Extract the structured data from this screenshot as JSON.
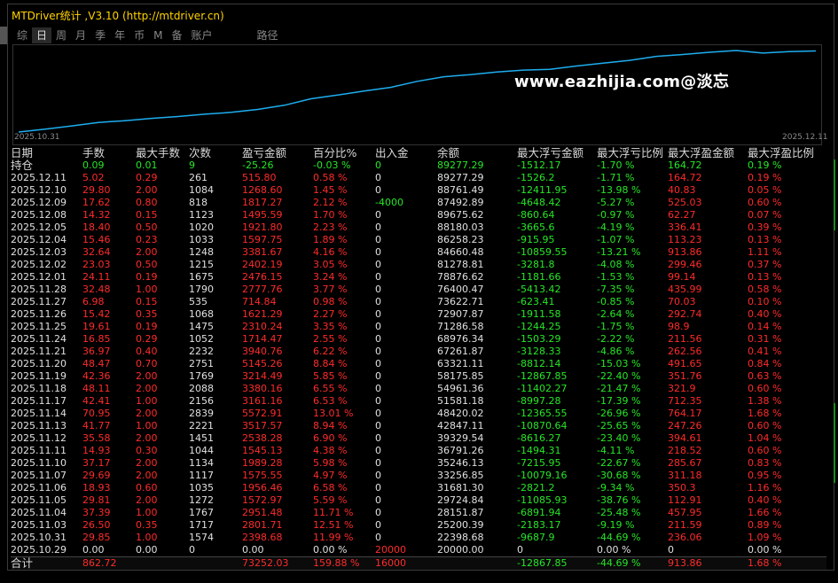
{
  "window": {
    "title": "MTDriver统计 ,V3.10 (http://mtdriver.cn)"
  },
  "tabs": [
    {
      "label": "综",
      "active": false
    },
    {
      "label": "日",
      "active": true
    },
    {
      "label": "周",
      "active": false
    },
    {
      "label": "月",
      "active": false
    },
    {
      "label": "季",
      "active": false
    },
    {
      "label": "年",
      "active": false
    },
    {
      "label": "币",
      "active": false
    },
    {
      "label": "M",
      "active": false
    },
    {
      "label": "备",
      "active": false
    },
    {
      "label": "账户",
      "active": false
    },
    {
      "label": "路径",
      "active": false
    }
  ],
  "chart": {
    "watermark": "www.eazhijia.com@淡忘",
    "x_start": "2025.10.31",
    "x_end": "2025.12.11",
    "line_color": "#1eaef0"
  },
  "chart_data": {
    "type": "line",
    "x": [
      "2025.10.29",
      "2025.10.31",
      "2025.11.03",
      "2025.11.04",
      "2025.11.05",
      "2025.11.06",
      "2025.11.07",
      "2025.11.10",
      "2025.11.11",
      "2025.11.12",
      "2025.11.13",
      "2025.11.14",
      "2025.11.17",
      "2025.11.18",
      "2025.11.19",
      "2025.11.20",
      "2025.11.21",
      "2025.11.24",
      "2025.11.25",
      "2025.11.26",
      "2025.11.27",
      "2025.11.28",
      "2025.12.01",
      "2025.12.02",
      "2025.12.03",
      "2025.12.04",
      "2025.12.05",
      "2025.12.08",
      "2025.12.09",
      "2025.12.10",
      "2025.12.11"
    ],
    "values": [
      20000.0,
      22398.68,
      25200.39,
      28151.87,
      29724.84,
      31681.3,
      33256.85,
      35246.13,
      36791.26,
      39329.54,
      42847.11,
      48420.02,
      51581.18,
      54961.36,
      58175.85,
      63321.11,
      67261.87,
      68976.34,
      71286.58,
      72907.87,
      73622.71,
      76400.47,
      78876.62,
      81278.81,
      84660.48,
      86258.23,
      88180.03,
      89675.62,
      87492.89,
      88761.49,
      89277.29
    ]
  },
  "headers": [
    "日期",
    "手数",
    "最大手数",
    "次数",
    "盈亏金额",
    "百分比%",
    "出入金",
    "余额",
    "最大浮亏金额",
    "最大浮亏比例",
    "最大浮盈金额",
    "最大浮盈比例"
  ],
  "holding": [
    "持仓",
    "0.09",
    "0.01",
    "9",
    "-25.26",
    "-0.03 %",
    "0",
    "89277.29",
    "-1512.17",
    "-1.70 %",
    "164.72",
    "0.19 %"
  ],
  "rows": [
    [
      "2025.12.11",
      "5.02",
      "0.29",
      "261",
      "515.80",
      "0.58 %",
      "0",
      "89277.29",
      "-1526.2",
      "-1.71 %",
      "164.72",
      "0.19 %"
    ],
    [
      "2025.12.10",
      "29.80",
      "2.00",
      "1084",
      "1268.60",
      "1.45 %",
      "0",
      "88761.49",
      "-12411.95",
      "-13.98 %",
      "40.83",
      "0.05 %"
    ],
    [
      "2025.12.09",
      "17.62",
      "0.80",
      "818",
      "1817.27",
      "2.12 %",
      "-4000",
      "87492.89",
      "-4648.42",
      "-5.27 %",
      "525.03",
      "0.60 %"
    ],
    [
      "2025.12.08",
      "14.32",
      "0.15",
      "1123",
      "1495.59",
      "1.70 %",
      "0",
      "89675.62",
      "-860.64",
      "-0.97 %",
      "62.27",
      "0.07 %"
    ],
    [
      "2025.12.05",
      "18.40",
      "0.50",
      "1020",
      "1921.80",
      "2.23 %",
      "0",
      "88180.03",
      "-3665.6",
      "-4.19 %",
      "336.41",
      "0.39 %"
    ],
    [
      "2025.12.04",
      "15.46",
      "0.23",
      "1033",
      "1597.75",
      "1.89 %",
      "0",
      "86258.23",
      "-915.95",
      "-1.07 %",
      "113.23",
      "0.13 %"
    ],
    [
      "2025.12.03",
      "32.64",
      "2.00",
      "1248",
      "3381.67",
      "4.16 %",
      "0",
      "84660.48",
      "-10859.55",
      "-13.21 %",
      "913.86",
      "1.11 %"
    ],
    [
      "2025.12.02",
      "23.03",
      "0.50",
      "1215",
      "2402.19",
      "3.05 %",
      "0",
      "81278.81",
      "-3281.8",
      "-4.08 %",
      "299.46",
      "0.37 %"
    ],
    [
      "2025.12.01",
      "24.11",
      "0.19",
      "1675",
      "2476.15",
      "3.24 %",
      "0",
      "78876.62",
      "-1181.66",
      "-1.53 %",
      "99.14",
      "0.13 %"
    ],
    [
      "2025.11.28",
      "32.48",
      "1.00",
      "1790",
      "2777.76",
      "3.77 %",
      "0",
      "76400.47",
      "-5413.42",
      "-7.35 %",
      "435.99",
      "0.58 %"
    ],
    [
      "2025.11.27",
      "6.98",
      "0.15",
      "535",
      "714.84",
      "0.98 %",
      "0",
      "73622.71",
      "-623.41",
      "-0.85 %",
      "70.03",
      "0.10 %"
    ],
    [
      "2025.11.26",
      "15.42",
      "0.35",
      "1068",
      "1621.29",
      "2.27 %",
      "0",
      "72907.87",
      "-1911.58",
      "-2.64 %",
      "292.74",
      "0.40 %"
    ],
    [
      "2025.11.25",
      "19.61",
      "0.19",
      "1475",
      "2310.24",
      "3.35 %",
      "0",
      "71286.58",
      "-1244.25",
      "-1.75 %",
      "98.9",
      "0.14 %"
    ],
    [
      "2025.11.24",
      "16.85",
      "0.29",
      "1052",
      "1714.47",
      "2.55 %",
      "0",
      "68976.34",
      "-1503.29",
      "-2.22 %",
      "211.56",
      "0.31 %"
    ],
    [
      "2025.11.21",
      "36.97",
      "0.40",
      "2232",
      "3940.76",
      "6.22 %",
      "0",
      "67261.87",
      "-3128.33",
      "-4.86 %",
      "262.56",
      "0.41 %"
    ],
    [
      "2025.11.20",
      "48.47",
      "0.70",
      "2751",
      "5145.26",
      "8.84 %",
      "0",
      "63321.11",
      "-8812.14",
      "-15.03 %",
      "491.65",
      "0.84 %"
    ],
    [
      "2025.11.19",
      "42.36",
      "2.00",
      "1769",
      "3214.49",
      "5.85 %",
      "0",
      "58175.85",
      "-12867.85",
      "-22.40 %",
      "351.76",
      "0.63 %"
    ],
    [
      "2025.11.18",
      "48.11",
      "2.00",
      "2088",
      "3380.16",
      "6.55 %",
      "0",
      "54961.36",
      "-11402.27",
      "-21.47 %",
      "321.9",
      "0.60 %"
    ],
    [
      "2025.11.17",
      "42.41",
      "1.00",
      "2156",
      "3161.16",
      "6.53 %",
      "0",
      "51581.18",
      "-8997.28",
      "-17.39 %",
      "712.35",
      "1.38 %"
    ],
    [
      "2025.11.14",
      "70.95",
      "2.00",
      "2839",
      "5572.91",
      "13.01 %",
      "0",
      "48420.02",
      "-12365.55",
      "-26.96 %",
      "764.17",
      "1.68 %"
    ],
    [
      "2025.11.13",
      "41.77",
      "1.00",
      "2221",
      "3517.57",
      "8.94 %",
      "0",
      "42847.11",
      "-10870.64",
      "-25.65 %",
      "247.26",
      "0.60 %"
    ],
    [
      "2025.11.12",
      "35.58",
      "2.00",
      "1451",
      "2538.28",
      "6.90 %",
      "0",
      "39329.54",
      "-8616.27",
      "-23.40 %",
      "394.61",
      "1.04 %"
    ],
    [
      "2025.11.11",
      "14.93",
      "0.30",
      "1044",
      "1545.13",
      "4.38 %",
      "0",
      "36791.26",
      "-1494.31",
      "-4.11 %",
      "218.52",
      "0.60 %"
    ],
    [
      "2025.11.10",
      "37.17",
      "2.00",
      "1134",
      "1989.28",
      "5.98 %",
      "0",
      "35246.13",
      "-7215.95",
      "-22.67 %",
      "285.67",
      "0.83 %"
    ],
    [
      "2025.11.07",
      "29.69",
      "2.00",
      "1117",
      "1575.55",
      "4.97 %",
      "0",
      "33256.85",
      "-10079.16",
      "-30.68 %",
      "311.18",
      "0.95 %"
    ],
    [
      "2025.11.06",
      "18.93",
      "0.60",
      "1035",
      "1956.46",
      "6.58 %",
      "0",
      "31681.30",
      "-2821.2",
      "-9.34 %",
      "350.3",
      "1.16 %"
    ],
    [
      "2025.11.05",
      "29.81",
      "2.00",
      "1272",
      "1572.97",
      "5.59 %",
      "0",
      "29724.84",
      "-11085.93",
      "-38.76 %",
      "112.91",
      "0.40 %"
    ],
    [
      "2025.11.04",
      "37.39",
      "1.00",
      "1767",
      "2951.48",
      "11.71 %",
      "0",
      "28151.87",
      "-6891.94",
      "-25.48 %",
      "457.95",
      "1.66 %"
    ],
    [
      "2025.11.03",
      "26.50",
      "0.35",
      "1717",
      "2801.71",
      "12.51 %",
      "0",
      "25200.39",
      "-2183.17",
      "-9.19 %",
      "211.59",
      "0.89 %"
    ],
    [
      "2025.10.31",
      "29.85",
      "1.00",
      "1574",
      "2398.68",
      "11.99 %",
      "0",
      "22398.68",
      "-9687.9",
      "-44.69 %",
      "236.06",
      "1.09 %"
    ],
    [
      "2025.10.29",
      "0.00",
      "0.00",
      "0",
      "0.00",
      "0.00 %",
      "20000",
      "20000.00",
      "0",
      "0.00 %",
      "0",
      "0.00 %"
    ]
  ],
  "total": [
    "合计",
    "862.72",
    "",
    "",
    "73252.03",
    "159.88 %",
    "16000",
    "",
    "-12867.85",
    "-44.69 %",
    "913.86",
    "1.68 %"
  ]
}
